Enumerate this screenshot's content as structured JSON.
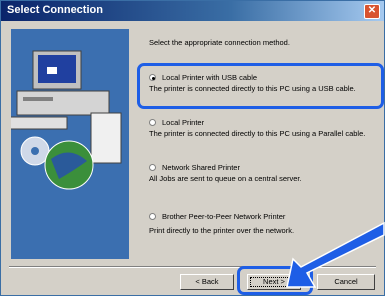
{
  "window": {
    "title": "Select Connection"
  },
  "instruction": "Select the appropriate connection method.",
  "options": [
    {
      "label": "Local Printer with USB cable",
      "desc": "The printer is connected directly to this PC using a USB cable.",
      "selected": true
    },
    {
      "label": "Local Printer",
      "desc": "The printer is connected directly to this PC using a Parallel cable.",
      "selected": false
    },
    {
      "label": "Network Shared Printer",
      "desc": "All Jobs are sent to queue on a central server.",
      "selected": false
    },
    {
      "label": "Brother Peer-to-Peer Network Printer",
      "desc": "Print directly to the printer over the network.",
      "selected": false
    }
  ],
  "buttons": {
    "back": "< Back",
    "next": "Next >",
    "cancel": "Cancel"
  },
  "colors": {
    "highlight": "#1e5ee6",
    "titlebar": "#0a246a",
    "art": "#3b6fb0"
  }
}
